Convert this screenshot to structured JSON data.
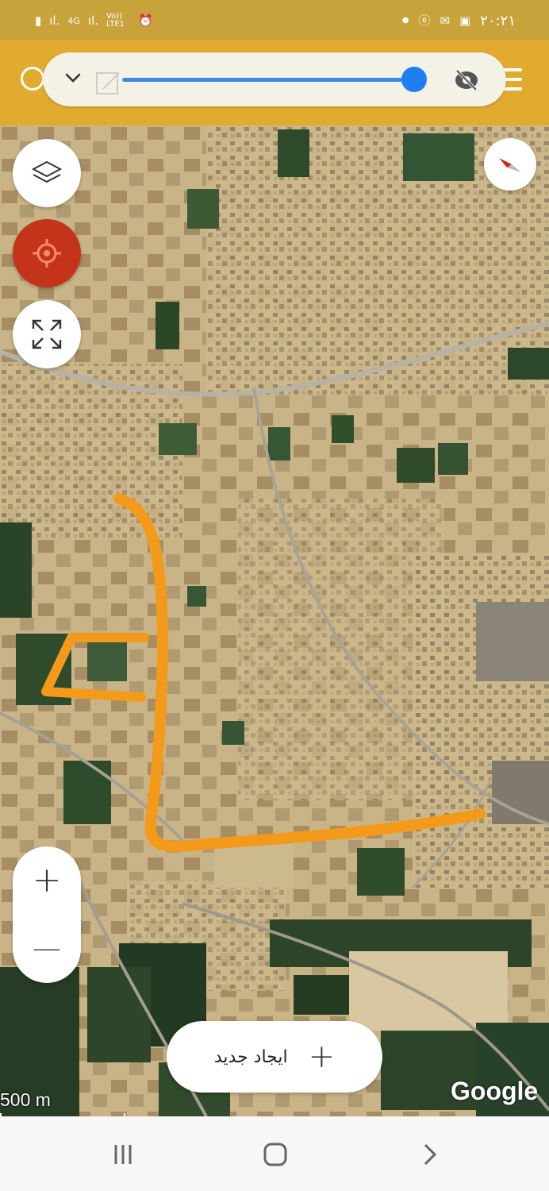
{
  "status_bar": {
    "time": "۲۰:۲۱",
    "network_left": "4G",
    "network_lte": "Vo)) LTE1",
    "icons": [
      "battery-icon",
      "signal-icon",
      "signal-icon",
      "alarm-icon",
      "dot-icon",
      "edge-icon",
      "message-icon",
      "image-icon"
    ]
  },
  "top_bar": {
    "icons": [
      "search-icon",
      "chevron-down-icon",
      "layers-ghost-icon",
      "visibility-off-icon",
      "menu-icon"
    ],
    "slider_value": 0.98,
    "accent": "#e0ab2f",
    "slider_color": "#1f7ff0"
  },
  "map": {
    "provider": "Google",
    "scale_label": "500 m",
    "route_color": "#f39a1a",
    "controls": [
      "layers-icon",
      "my-location-icon",
      "fullscreen-icon",
      "compass-icon"
    ]
  },
  "zoom": {
    "in_label": "+",
    "out_label": "—"
  },
  "create_button": {
    "label": "ایجاد جدید",
    "icon": "+"
  },
  "nav_bar": {
    "icons": [
      "recent-apps-icon",
      "home-icon",
      "back-icon"
    ]
  }
}
